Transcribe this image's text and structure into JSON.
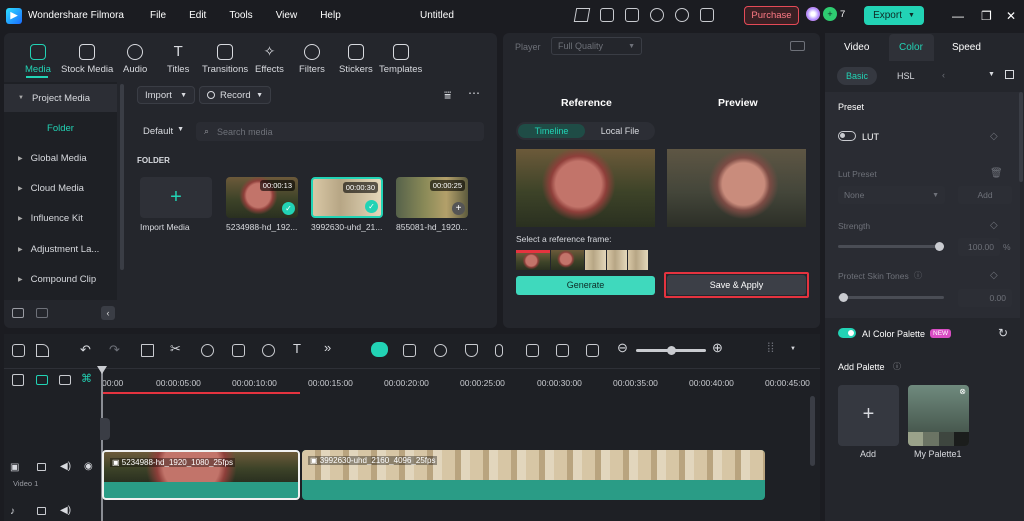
{
  "app": {
    "name": "Wondershare Filmora",
    "title": "Untitled",
    "credits": "7",
    "purchase": "Purchase",
    "export": "Export"
  },
  "menu": [
    "File",
    "Edit",
    "Tools",
    "View",
    "Help"
  ],
  "media_tabs": [
    {
      "label": "Media",
      "icon": "media-icon",
      "active": true
    },
    {
      "label": "Stock Media",
      "icon": "stock-media-icon"
    },
    {
      "label": "Audio",
      "icon": "music-note-icon"
    },
    {
      "label": "Titles",
      "icon": "text-t-icon"
    },
    {
      "label": "Transitions",
      "icon": "transitions-icon"
    },
    {
      "label": "Effects",
      "icon": "sparkle-icon"
    },
    {
      "label": "Filters",
      "icon": "filter-icon"
    },
    {
      "label": "Stickers",
      "icon": "sticker-icon"
    },
    {
      "label": "Templates",
      "icon": "templates-icon"
    }
  ],
  "library_nav": {
    "project_media": "Project Media",
    "folder": "Folder",
    "items": [
      "Global Media",
      "Cloud Media",
      "Influence Kit",
      "Adjustment La...",
      "Compound Clip"
    ]
  },
  "media_toolbar": {
    "import": "Import",
    "record": "Record",
    "sort": "Default",
    "search_placeholder": "Search media"
  },
  "folder_label": "FOLDER",
  "import_media": "Import Media",
  "clips": [
    {
      "name": "5234988-hd_192...",
      "duration": "00:00:13"
    },
    {
      "name": "3992630-uhd_21...",
      "duration": "00:00:30"
    },
    {
      "name": "855081-hd_1920...",
      "duration": "00:00:25"
    }
  ],
  "player": {
    "label": "Player",
    "quality": "Full Quality",
    "reference": "Reference",
    "preview": "Preview",
    "tab_timeline": "Timeline",
    "tab_local": "Local File",
    "select_frame": "Select a reference frame:",
    "generate": "Generate",
    "save_apply": "Save & Apply"
  },
  "right_panel": {
    "tabs": [
      "Video",
      "Color",
      "Speed"
    ],
    "subtabs": [
      "Basic",
      "HSL"
    ],
    "preset": "Preset",
    "lut": "LUT",
    "lut_preset": "Lut Preset",
    "lut_value": "None",
    "add": "Add",
    "strength": "Strength",
    "strength_value": "100.00",
    "strength_unit": "%",
    "protect_skin": "Protect Skin Tones",
    "protect_value": "0.00",
    "ai_palette": "AI Color Palette",
    "new_badge": "NEW",
    "add_palette": "Add Palette",
    "add_label": "Add",
    "my_palette": "My Palette1"
  },
  "timeline": {
    "ticks": [
      "00:00",
      "00:00:05:00",
      "00:00:10:00",
      "00:00:15:00",
      "00:00:20:00",
      "00:00:25:00",
      "00:00:30:00",
      "00:00:35:00",
      "00:00:40:00",
      "00:00:45:00"
    ],
    "track_label": "Video 1",
    "clip1": "5234988-hd_1920_1080_25fps",
    "clip2": "3992630-uhd_2160_4096_25fps"
  },
  "colors": {
    "accent": "#22d3b5",
    "purchase": "#e54a57",
    "danger_outline": "#e5333f"
  }
}
